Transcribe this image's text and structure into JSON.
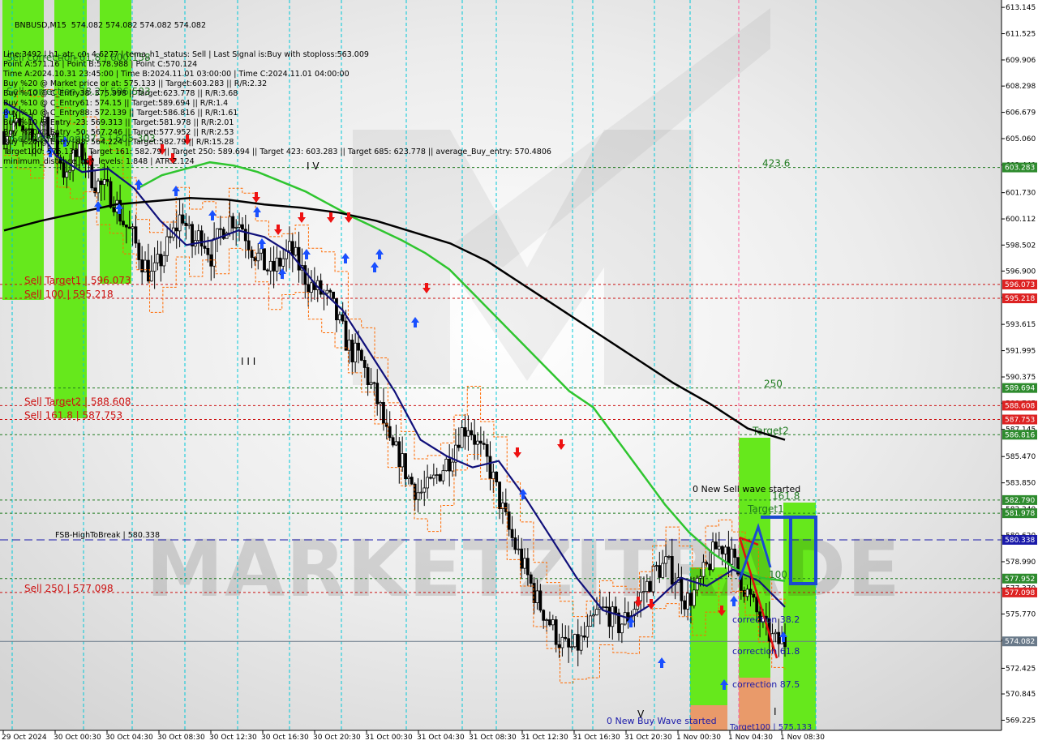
{
  "header": {
    "symbol_line": "BNBUSD,M15  574.082 574.082 574.082 574.082",
    "info_lines": [
      "Line:3492 | h1_atr_c0: 4.6277 | tema_h1_status: Sell | Last Signal is:Buy with stoploss:563.009",
      "Point A:571.16 | Point B:578.988 | Point C:570.124",
      "Time A:2024.10.31 23:45:00 | Time B:2024.11.01 03:00:00 | Time C:2024.11.01 04:00:00",
      "Buy %20 @ Market price or at: 575.133 || Target:603.283 || R/R:2.32",
      "Buy %10 @ C_Entry38: 575.998 || Target:623.778 || R/R:3.68",
      "Buy %10 @ C_Entry61: 574.15 || Target:589.694 || R/R:1.4",
      "Buy %10 @ C_Entry88: 572.139 || Target:586.816 || R/R:1.61",
      "Buy %10 @ Entry -23: 569.313 || Target:581.978 || R/R:2.01",
      "Buy %20 @ Entry -50: 567.246 || Target:577.952 || R/R:2.53",
      "Buy %20 @ Entry -88: 564.224 || Target:582.79 || R/R:15.28",
      "Target100: 575.133 || Target 161: 582.79 || Target 250: 589.694 || Target 423: 603.283 || Target 685: 623.778 || average_Buy_entry: 570.4806",
      "minimum_distance_buy_levels: 1.848 | ATR:2.124"
    ]
  },
  "watermark": "MARKETZITRADE",
  "colors": {
    "bull_zone": "#66e81c",
    "entry_zone": "#e99a6a",
    "bear_zone": "#ff4c4c",
    "ema_green": "#2fc52f",
    "tema_blue": "#10107a",
    "ma_black": "#000000",
    "high_low_orange": "#ff6a00",
    "level_green": "#1f7a1f",
    "level_red": "#cc1111",
    "level_blue": "#1a1aaa",
    "vline_cyan": "#00c8d8",
    "vline_pink": "#ff5a9a"
  },
  "price_axis": {
    "min": 568.6,
    "max": 613.6,
    "ticks": [
      "613.145",
      "611.525",
      "609.906",
      "608.298",
      "606.679",
      "605.060",
      "603.440",
      "601.730",
      "600.112",
      "598.502",
      "596.900",
      "595.270",
      "593.615",
      "591.995",
      "590.375",
      "588.765",
      "587.145",
      "585.470",
      "583.850",
      "582.240",
      "580.620",
      "578.990",
      "577.370",
      "575.770",
      "574.150",
      "572.425",
      "570.845",
      "569.225"
    ]
  },
  "time_axis": {
    "labels": [
      "29 Oct 2024",
      "30 Oct 00:30",
      "30 Oct 04:30",
      "30 Oct 08:30",
      "30 Oct 12:30",
      "30 Oct 16:30",
      "30 Oct 20:30",
      "31 Oct 00:30",
      "31 Oct 04:30",
      "31 Oct 08:30",
      "31 Oct 12:30",
      "31 Oct 16:30",
      "31 Oct 20:30",
      "1 Nov 00:30",
      "1 Nov 04:30",
      "1 Nov 08:30"
    ]
  },
  "levels": [
    {
      "price": 603.283,
      "label": "603.283",
      "color": "green",
      "caption": "423.6",
      "caption_color": "green"
    },
    {
      "price": 596.073,
      "label": "596.073",
      "color": "red",
      "caption": "Sell Target1 | 596.073",
      "caption_color": "red"
    },
    {
      "price": 595.218,
      "label": "595.218",
      "color": "red",
      "caption": "Sell 100 | 595.218",
      "caption_color": "red"
    },
    {
      "price": 589.694,
      "label": "589.694",
      "color": "green",
      "caption": "250",
      "caption_color": "green"
    },
    {
      "price": 588.608,
      "label": "588.608",
      "color": "red",
      "caption": "Sell Target2 | 588.608",
      "caption_color": "red"
    },
    {
      "price": 587.753,
      "label": "587.753",
      "color": "red",
      "caption": "Sell 161.8 | 587.753",
      "caption_color": "red"
    },
    {
      "price": 586.816,
      "label": "586.816",
      "color": "green",
      "caption": "Target2",
      "caption_color": "green"
    },
    {
      "price": 582.79,
      "label": "582.790",
      "color": "green",
      "caption": "161.8",
      "caption_color": "green"
    },
    {
      "price": 581.978,
      "label": "581.978",
      "color": "green",
      "caption": "Target1",
      "caption_color": "green"
    },
    {
      "price": 580.338,
      "label": "580.338",
      "color": "blue",
      "caption": "FSB-HighToBreak | 580.338",
      "caption_color": "black"
    },
    {
      "price": 577.952,
      "label": "577.952",
      "color": "green",
      "caption": "100",
      "caption_color": "green"
    },
    {
      "price": 577.098,
      "label": "577.098",
      "color": "red",
      "caption": "Sell 250 | 577.098",
      "caption_color": "red"
    },
    {
      "price": 574.082,
      "label": "574.082",
      "color": "gray",
      "caption": "",
      "caption_color": "black"
    }
  ],
  "annotations": [
    {
      "text": "Sell correction 87.5 | 605.303",
      "kind": "green"
    },
    {
      "text": "Sell correction 61.8 | 600.158",
      "kind": "green"
    },
    {
      "text": "Sell correction 38.2 | 596.593",
      "kind": "green"
    },
    {
      "text": "I V",
      "kind": "black"
    },
    {
      "text": "I I I",
      "kind": "black"
    },
    {
      "text": "0 New Sell wave started",
      "kind": "black"
    },
    {
      "text": "0 New Buy Wave started",
      "kind": "blue"
    },
    {
      "text": "V",
      "kind": "black"
    },
    {
      "text": "I",
      "kind": "black"
    },
    {
      "text": "correction 38.2",
      "kind": "blue"
    },
    {
      "text": "correction 61.8",
      "kind": "blue"
    },
    {
      "text": "correction 87.5",
      "kind": "blue"
    },
    {
      "text": "Target100 | 575.133",
      "kind": "blue"
    }
  ],
  "chart_data": {
    "type": "candlestick",
    "symbol": "BNBUSD",
    "timeframe": "M15",
    "ylim": [
      568.6,
      613.6
    ],
    "grid": false,
    "x": [
      "29 Oct 2024",
      "30 Oct 00:30",
      "30 Oct 04:30",
      "30 Oct 08:30",
      "30 Oct 12:30",
      "30 Oct 16:30",
      "30 Oct 20:30",
      "31 Oct 00:30",
      "31 Oct 04:30",
      "31 Oct 08:30",
      "31 Oct 12:30",
      "31 Oct 16:30",
      "31 Oct 20:30",
      "1 Nov 00:30",
      "1 Nov 04:30",
      "1 Nov 08:30"
    ],
    "close_path": [
      605.5,
      606.0,
      605.2,
      604.8,
      606.5,
      604.9,
      603.0,
      603.8,
      604.2,
      602.5,
      602.0,
      601.5,
      600.0,
      599.0,
      597.5,
      596.5,
      597.8,
      599.0,
      600.5,
      598.5,
      599.2,
      597.8,
      599.5,
      600.2,
      599.8,
      598.4,
      597.5,
      596.8,
      597.5,
      598.2,
      597.0,
      596.0,
      595.6,
      595.0,
      593.5,
      592.0,
      591.5,
      590.0,
      588.5,
      586.0,
      585.5,
      584.0,
      583.2,
      583.5,
      584.5,
      585.3,
      586.8,
      587.5,
      586.0,
      585.0,
      583.0,
      581.0,
      579.5,
      578.0,
      576.5,
      575.5,
      574.3,
      573.5,
      573.8,
      574.5,
      575.8,
      576.0,
      575.0,
      575.5,
      576.5,
      577.5,
      578.5,
      578.8,
      578.0,
      576.5,
      577.2,
      578.5,
      579.8,
      580.0,
      578.6,
      577.3,
      576.0,
      574.8,
      574.0,
      574.082
    ],
    "moving_averages": [
      {
        "name": "EMA",
        "color": "green",
        "points": [
          602.0,
          602.8,
          603.2,
          603.6,
          603.4,
          603.0,
          602.4,
          601.8,
          601.0,
          600.2,
          599.5,
          598.8,
          598.0,
          597.0,
          595.5,
          594.0,
          592.5,
          591.0,
          589.5,
          588.5,
          586.5,
          584.5,
          582.5,
          580.8,
          579.5,
          578.5,
          578.0,
          577.8
        ]
      },
      {
        "name": "TEMA",
        "color": "blue",
        "points": [
          607.3,
          606.4,
          604.0,
          603.0,
          603.2,
          602.0,
          600.0,
          598.5,
          598.8,
          599.4,
          599.0,
          598.0,
          596.0,
          594.5,
          592.0,
          589.5,
          586.5,
          585.5,
          584.8,
          585.2,
          583.0,
          580.5,
          578.0,
          576.0,
          575.5,
          576.5,
          578.0,
          577.5,
          578.5,
          577.8,
          576.2
        ]
      },
      {
        "name": "MA",
        "color": "black",
        "points": [
          599.4,
          600.0,
          600.5,
          601.0,
          601.2,
          601.4,
          601.3,
          601.0,
          600.8,
          600.5,
          600.0,
          599.3,
          598.6,
          597.5,
          596.0,
          594.5,
          593.0,
          591.5,
          590.0,
          588.7,
          587.2,
          586.5
        ]
      }
    ]
  }
}
